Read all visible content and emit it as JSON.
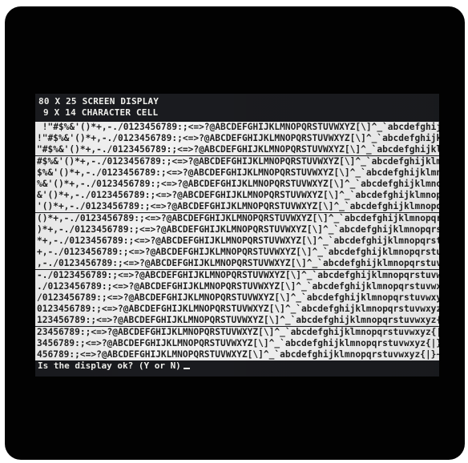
{
  "header": {
    "line1": "80 X 25 SCREEN DISPLAY",
    "line2": "9 X 14 CHARACTER CELL"
  },
  "rows": [
    " !\"#$%&'()*+,-./0123456789:;<=>?@ABCDEFGHIJKLMNOPQRSTUVWXYZ[\\]^_`abcdefghijklmn",
    "!\"#$%&'()*+,-./0123456789:;<=>?@ABCDEFGHIJKLMNOPQRSTUVWXYZ[\\]^_`abcdefghijklmno",
    "\"#$%&'()*+,-./0123456789:;<=>?@ABCDEFGHIJKLMNOPQRSTUVWXYZ[\\]^_`abcdefghijklmnop",
    "#$%&'()*+,-./0123456789:;<=>?@ABCDEFGHIJKLMNOPQRSTUVWXYZ[\\]^_`abcdefghijklmnopq",
    "$%&'()*+,-./0123456789:;<=>?@ABCDEFGHIJKLMNOPQRSTUVWXYZ[\\]^_`abcdefghijklmnopqr",
    "%&'()*+,-./0123456789:;<=>?@ABCDEFGHIJKLMNOPQRSTUVWXYZ[\\]^_`abcdefghijklmnopqrs",
    "&'()*+,-./0123456789:;<=>?@ABCDEFGHIJKLMNOPQRSTUVWXYZ[\\]^_`abcdefghijklmnopqrst",
    "'()*+,-./0123456789:;<=>?@ABCDEFGHIJKLMNOPQRSTUVWXYZ[\\]^_`abcdefghijklmnopqrstu",
    "()*+,-./0123456789:;<=>?@ABCDEFGHIJKLMNOPQRSTUVWXYZ[\\]^_`abcdefghijklmnopqrstuv",
    ")*+,-./0123456789:;<=>?@ABCDEFGHIJKLMNOPQRSTUVWXYZ[\\]^_`abcdefghijklmnopqrstuvw",
    "*+,-./0123456789:;<=>?@ABCDEFGHIJKLMNOPQRSTUVWXYZ[\\]^_`abcdefghijklmnopqrstuvwx",
    "+,-./0123456789:;<=>?@ABCDEFGHIJKLMNOPQRSTUVWXYZ[\\]^_`abcdefghijklmnopqrstuvwxy",
    ",-./0123456789:;<=>?@ABCDEFGHIJKLMNOPQRSTUVWXYZ[\\]^_`abcdefghijklmnopqrstuvwxyz",
    "-./0123456789:;<=>?@ABCDEFGHIJKLMNOPQRSTUVWXYZ[\\]^_`abcdefghijklmnopqrstuvwxyz{",
    "./0123456789:;<=>?@ABCDEFGHIJKLMNOPQRSTUVWXYZ[\\]^_`abcdefghijklmnopqrstuvwxyz{|",
    "/0123456789:;<=>?@ABCDEFGHIJKLMNOPQRSTUVWXYZ[\\]^_`abcdefghijklmnopqrstuvwxyz{|}",
    "0123456789:;<=>?@ABCDEFGHIJKLMNOPQRSTUVWXYZ[\\]^_`abcdefghijklmnopqrstuvwxyz{|}~",
    "123456789:;<=>?@ABCDEFGHIJKLMNOPQRSTUVWXYZ[\\]^_`abcdefghijklmnopqrstuvwxyz{|}~",
    "23456789:;<=>?@ABCDEFGHIJKLMNOPQRSTUVWXYZ[\\]^_`abcdefghijklmnopqrstuvwxyz{|}~",
    "3456789:;<=>?@ABCDEFGHIJKLMNOPQRSTUVWXYZ[\\]^_`abcdefghijklmnopqrstuvwxyz{|}~",
    "456789:;<=>?@ABCDEFGHIJKLMNOPQRSTUVWXYZ[\\]^_`abcdefghijklmnopqrstuvwxyz{|}~ !\""
  ],
  "prompt": "Is the display ok? (Y or N)",
  "colors": {
    "bezel": "#020202",
    "screen_bg": "#1a1b1f",
    "row_bg": "#f3f3f3",
    "row_text": "#222222",
    "screen_text": "#f4f4f0"
  }
}
